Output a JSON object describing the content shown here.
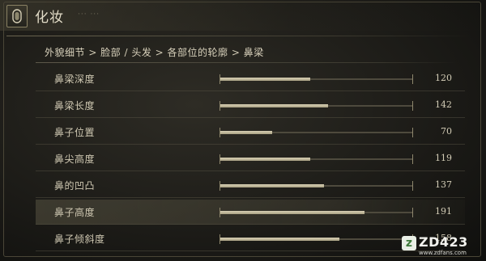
{
  "header": {
    "title": "化妆",
    "subtitle": "··· ···",
    "icon": "mirror-icon"
  },
  "breadcrumb": "外貌细节 > 脸部 / 头发 > 各部位的轮廓 > 鼻梁",
  "rows": [
    {
      "label": "鼻梁深度",
      "value": "120",
      "fill": 0.47,
      "selected": false
    },
    {
      "label": "鼻梁长度",
      "value": "142",
      "fill": 0.56,
      "selected": false
    },
    {
      "label": "鼻子位置",
      "value": "70",
      "fill": 0.27,
      "selected": false
    },
    {
      "label": "鼻尖高度",
      "value": "119",
      "fill": 0.47,
      "selected": false
    },
    {
      "label": "鼻的凹凸",
      "value": "137",
      "fill": 0.54,
      "selected": false
    },
    {
      "label": "鼻子高度",
      "value": "191",
      "fill": 0.75,
      "selected": true
    },
    {
      "label": "鼻子倾斜度",
      "value": "158",
      "fill": 0.62,
      "selected": false
    }
  ],
  "watermark": {
    "logo": "z",
    "name": "ZD423",
    "url": "www.zdfans.com"
  },
  "colors": {
    "fill": "#d8d0b4",
    "track": "#4e4a3d",
    "text": "#cfc8b2"
  }
}
